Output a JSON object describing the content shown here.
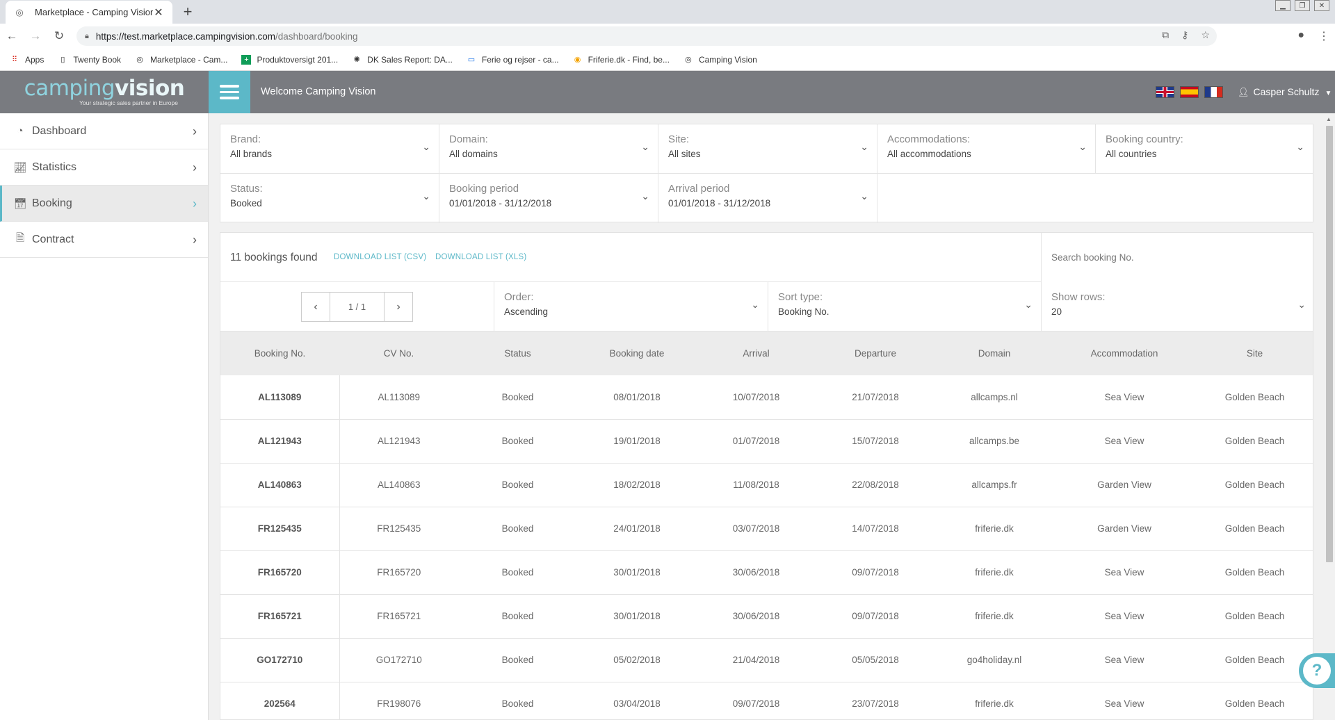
{
  "browser": {
    "tab_title": "Marketplace - Camping Vision",
    "tab_close": "✕",
    "new_tab": "+",
    "url_host": "https://test.marketplace.campingvision.com",
    "url_path": "/dashboard/booking",
    "bookmarks": [
      {
        "label": "Apps",
        "icon": "apps-grid-icon"
      },
      {
        "label": "Twenty Book",
        "icon": "page-icon"
      },
      {
        "label": "Marketplace - Cam...",
        "icon": "campingvision-icon"
      },
      {
        "label": "Produktoversigt 201...",
        "icon": "sheets-icon"
      },
      {
        "label": "DK Sales Report: DA...",
        "icon": "chart-icon"
      },
      {
        "label": "Ferie og rejser - ca...",
        "icon": "travel-icon"
      },
      {
        "label": "Friferie.dk - Find, be...",
        "icon": "friferie-icon"
      },
      {
        "label": "Camping Vision",
        "icon": "campingvision-icon"
      }
    ]
  },
  "header": {
    "logo_part1": "camping",
    "logo_part2": "vision",
    "logo_tagline": "Your strategic sales partner in Europe",
    "welcome": "Welcome Camping Vision",
    "user_name": "Casper Schultz"
  },
  "sidebar": {
    "items": [
      {
        "label": "Dashboard",
        "icon": "dashboard-gauge-icon"
      },
      {
        "label": "Statistics",
        "icon": "line-chart-icon"
      },
      {
        "label": "Booking",
        "icon": "calendar-check-icon"
      },
      {
        "label": "Contract",
        "icon": "document-icon"
      }
    ]
  },
  "filters": {
    "brand": {
      "label": "Brand:",
      "value": "All brands"
    },
    "domain": {
      "label": "Domain:",
      "value": "All domains"
    },
    "site": {
      "label": "Site:",
      "value": "All sites"
    },
    "accommodations": {
      "label": "Accommodations:",
      "value": "All accommodations"
    },
    "booking_country": {
      "label": "Booking country:",
      "value": "All countries"
    },
    "status": {
      "label": "Status:",
      "value": "Booked"
    },
    "booking_period": {
      "label": "Booking period",
      "value": "01/01/2018 - 31/12/2018"
    },
    "arrival_period": {
      "label": "Arrival period",
      "value": "01/01/2018 - 31/12/2018"
    }
  },
  "results": {
    "count_label": "11 bookings found",
    "download_csv": "DOWNLOAD LIST (CSV)",
    "download_xls": "DOWNLOAD LIST (XLS)",
    "search_placeholder": "Search booking No.",
    "pager": "1 / 1",
    "order": {
      "label": "Order:",
      "value": "Ascending"
    },
    "sort_type": {
      "label": "Sort type:",
      "value": "Booking No."
    },
    "show_rows": {
      "label": "Show rows:",
      "value": "20"
    }
  },
  "table": {
    "columns": [
      "Booking No.",
      "CV No.",
      "Status",
      "Booking date",
      "Arrival",
      "Departure",
      "Domain",
      "Accommodation",
      "Site"
    ],
    "rows": [
      [
        "AL113089",
        "AL113089",
        "Booked",
        "08/01/2018",
        "10/07/2018",
        "21/07/2018",
        "allcamps.nl",
        "Sea View",
        "Golden Beach"
      ],
      [
        "AL121943",
        "AL121943",
        "Booked",
        "19/01/2018",
        "01/07/2018",
        "15/07/2018",
        "allcamps.be",
        "Sea View",
        "Golden Beach"
      ],
      [
        "AL140863",
        "AL140863",
        "Booked",
        "18/02/2018",
        "11/08/2018",
        "22/08/2018",
        "allcamps.fr",
        "Garden View",
        "Golden Beach"
      ],
      [
        "FR125435",
        "FR125435",
        "Booked",
        "24/01/2018",
        "03/07/2018",
        "14/07/2018",
        "friferie.dk",
        "Garden View",
        "Golden Beach"
      ],
      [
        "FR165720",
        "FR165720",
        "Booked",
        "30/01/2018",
        "30/06/2018",
        "09/07/2018",
        "friferie.dk",
        "Sea View",
        "Golden Beach"
      ],
      [
        "FR165721",
        "FR165721",
        "Booked",
        "30/01/2018",
        "30/06/2018",
        "09/07/2018",
        "friferie.dk",
        "Sea View",
        "Golden Beach"
      ],
      [
        "GO172710",
        "GO172710",
        "Booked",
        "05/02/2018",
        "21/04/2018",
        "05/05/2018",
        "go4holiday.nl",
        "Sea View",
        "Golden Beach"
      ],
      [
        "202564",
        "FR198076",
        "Booked",
        "03/04/2018",
        "09/07/2018",
        "23/07/2018",
        "friferie.dk",
        "Sea View",
        "Golden Beach"
      ]
    ]
  },
  "help_icon": "?",
  "colors": {
    "accent": "#5cb8c8",
    "header_bg": "#797b80"
  }
}
